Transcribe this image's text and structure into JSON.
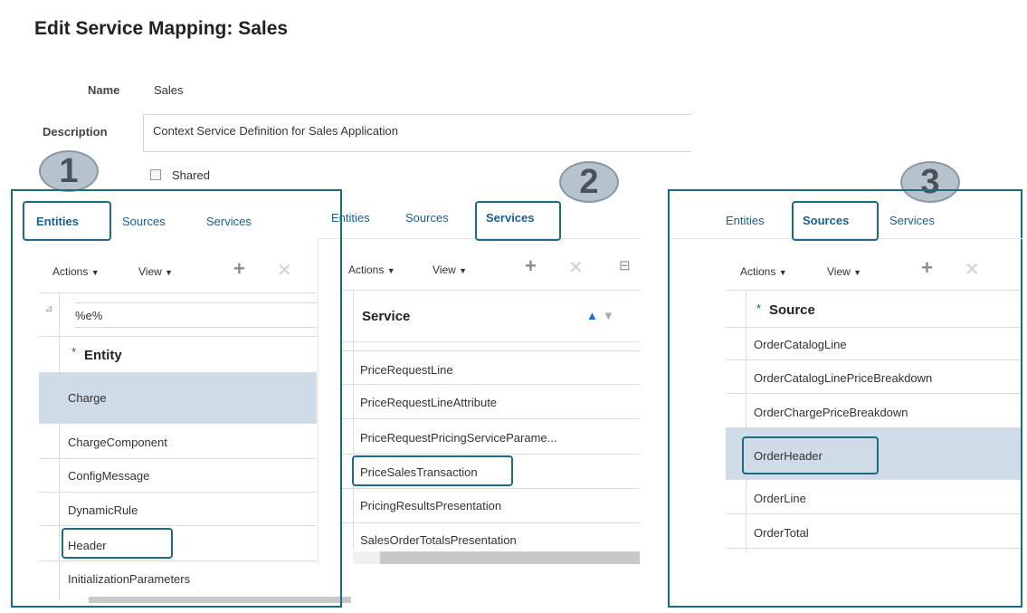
{
  "page": {
    "title": "Edit Service Mapping: Sales",
    "name_label": "Name",
    "name_value": "Sales",
    "description_label": "Description",
    "description_value": "Context Service Definition for Sales Application",
    "shared_label": "Shared"
  },
  "callouts": [
    "1",
    "2",
    "3"
  ],
  "toolbar": {
    "actions_label": "Actions",
    "view_label": "View"
  },
  "panel1": {
    "tabs": [
      "Entities",
      "Sources",
      "Services"
    ],
    "active_tab": "Entities",
    "filter_value": "%e%",
    "column_header_required": "*",
    "column_header": "Entity",
    "rows": [
      "Charge",
      "ChargeComponent",
      "ConfigMessage",
      "DynamicRule",
      "Header",
      "InitializationParameters"
    ],
    "selected_row": "Charge",
    "highlighted_row": "Header"
  },
  "panel2": {
    "tabs": [
      "Entities",
      "Sources",
      "Services"
    ],
    "active_tab": "Services",
    "column_header": "Service",
    "rows": [
      "PriceRequestLine",
      "PriceRequestLineAttribute",
      "PriceRequestPricingServiceParame...",
      "PriceSalesTransaction",
      "PricingResultsPresentation",
      "SalesOrderTotalsPresentation"
    ],
    "highlighted_row": "PriceSalesTransaction"
  },
  "panel3": {
    "tabs": [
      "Entities",
      "Sources",
      "Services"
    ],
    "active_tab": "Sources",
    "column_header_required": "*",
    "column_header": "Source",
    "rows": [
      "OrderCatalogLine",
      "OrderCatalogLinePriceBreakdown",
      "OrderChargePriceBreakdown",
      "OrderHeader",
      "OrderLine",
      "OrderTotal"
    ],
    "selected_row": "OrderHeader",
    "highlighted_row": "OrderHeader"
  },
  "colors": {
    "frame": "#1d6b80",
    "link": "#1a5f8e",
    "selected": "#cfdbe6"
  },
  "icons": [
    "plus-icon",
    "delete-icon",
    "filter-toggle-icon",
    "sort-ascending-icon",
    "sort-descending-icon",
    "caret-down-icon"
  ]
}
